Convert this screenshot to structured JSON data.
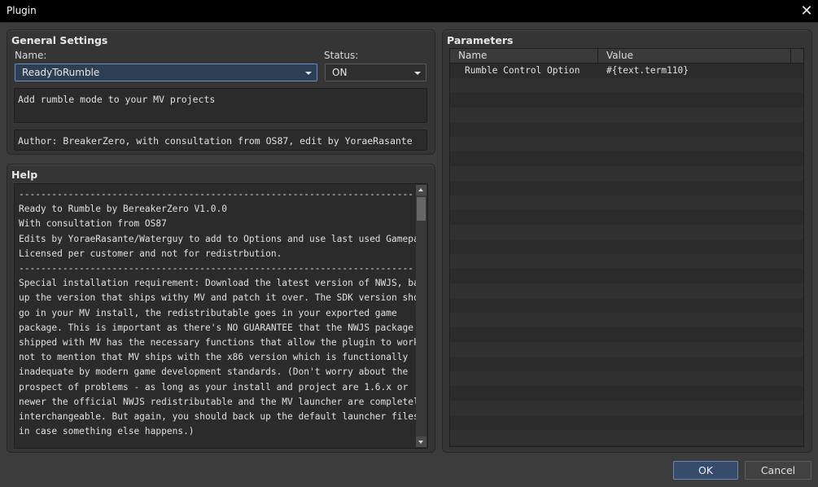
{
  "window": {
    "title": "Plugin",
    "close_glyph": "✕"
  },
  "general": {
    "title": "General Settings",
    "name_label": "Name:",
    "name_value": "ReadyToRumble",
    "status_label": "Status:",
    "status_value": "ON",
    "description": "Add rumble mode to your MV projects",
    "author": "Author: BreakerZero, with consultation from OS87, edit by YoraeRasante"
  },
  "help": {
    "title": "Help",
    "text": "------------------------------------------------------------------------\nReady to Rumble by BereakerZero V1.0.0\nWith consultation from OS87\nEdits by YoraeRasante/Waterguy to add to Options and use last used Gamepad\nLicensed per customer and not for redistrbution.\n------------------------------------------------------------------------\nSpecial installation requirement: Download the latest version of NWJS, back\nup the version that ships withy MV and patch it over. The SDK version should\ngo in your MV install, the redistributable goes in your exported game\npackage. This is important as there's NO GUARANTEE that the NWJS package\nshipped with MV has the necessary functions that allow the plugin to work,\nnot to mention that MV ships with the x86 version which is functionally\ninadequate by modern game development standards. (Don't worry about the\nprospect of problems - as long as your install and project are 1.6.x or\nnewer the official NWJS redistributable and the MV launcher are completely\ninterchangeable. But again, you should back up the default launcher files\nin case something else happens.)"
  },
  "parameters": {
    "title": "Parameters",
    "columns": [
      "Name",
      "Value"
    ],
    "rows": [
      {
        "name": "Rumble Control Option",
        "value": "#{text.term110}"
      }
    ]
  },
  "buttons": {
    "ok": "OK",
    "cancel": "Cancel"
  },
  "colors": {
    "accent": "#374c6a",
    "background": "#3c3c3c",
    "panel": "#353535"
  }
}
